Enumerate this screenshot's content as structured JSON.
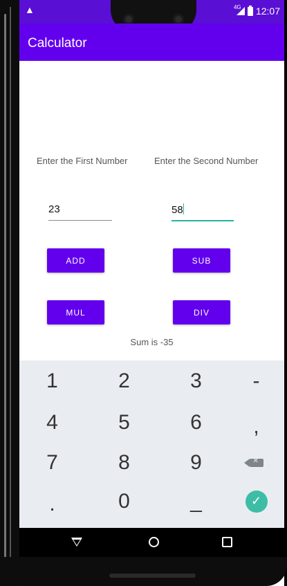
{
  "status_bar": {
    "notification_icon": "warning-triangle-icon",
    "network_label": "4G",
    "time": "12:07"
  },
  "app_bar": {
    "title": "Calculator"
  },
  "form": {
    "first_label": "Enter the First Number",
    "second_label": "Enter the Second Number",
    "first_value": "23",
    "second_value": "58"
  },
  "buttons": {
    "add": "ADD",
    "sub": "SUB",
    "mul": "MUL",
    "div": "DIV"
  },
  "result_text": "Sum is -35",
  "keyboard": {
    "keys": [
      "1",
      "2",
      "3",
      "-",
      "4",
      "5",
      "6",
      ",",
      "7",
      "8",
      "9",
      ".",
      "0",
      "_"
    ],
    "backspace_icon": "backspace-icon",
    "done_icon": "checkmark-icon"
  },
  "colors": {
    "primary": "#6200ee",
    "status_bar": "#5a0fd4",
    "accent": "#26b2a6",
    "keyboard_bg": "#e9edf1"
  }
}
